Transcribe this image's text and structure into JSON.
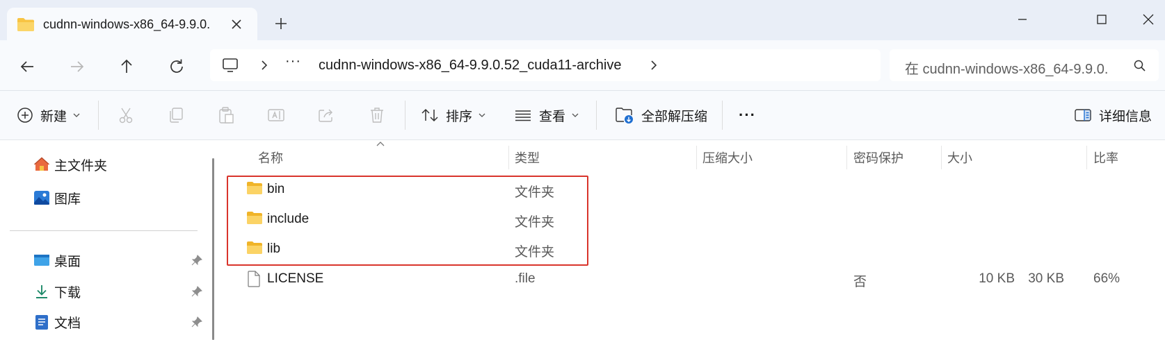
{
  "window": {
    "tab_title": "cudnn-windows-x86_64-9.9.0.",
    "icons": [
      "folder-icon",
      "close-icon",
      "plus-icon",
      "minimize-icon",
      "maximize-icon",
      "window-close-icon"
    ]
  },
  "navigation": {
    "dots": "···",
    "address_path": "cudnn-windows-x86_64-9.9.0.52_cuda11-archive",
    "search_placeholder": "在 cudnn-windows-x86_64-9.9.0.",
    "icons": [
      "back-arrow-icon",
      "forward-arrow-icon",
      "up-arrow-icon",
      "refresh-icon",
      "this-pc-icon",
      "chevron-right-icon",
      "search-icon"
    ]
  },
  "toolbar": {
    "new_label": "新建",
    "sort_label": "排序",
    "view_label": "查看",
    "extract_all_label": "全部解压缩",
    "more_label": "···",
    "details_label": "详细信息",
    "icons": [
      "cut-icon",
      "copy-icon",
      "paste-icon",
      "rename-icon",
      "share-icon",
      "delete-icon"
    ]
  },
  "sidebar": {
    "items": [
      {
        "label": "主文件夹",
        "icon": "home-icon",
        "pinned": false
      },
      {
        "label": "图库",
        "icon": "gallery-icon",
        "pinned": false
      },
      {
        "label": "桌面",
        "icon": "desktop-icon",
        "pinned": true
      },
      {
        "label": "下载",
        "icon": "download-icon",
        "pinned": true
      },
      {
        "label": "文档",
        "icon": "document-icon",
        "pinned": true
      }
    ]
  },
  "columns": {
    "name": "名称",
    "type": "类型",
    "compressed_size": "压缩大小",
    "password": "密码保护",
    "size": "大小",
    "ratio": "比率"
  },
  "files": [
    {
      "name": "bin",
      "type": "文件夹",
      "compressed_size": "",
      "password": "",
      "size": "",
      "ratio": "",
      "icon": "folder-icon"
    },
    {
      "name": "include",
      "type": "文件夹",
      "compressed_size": "",
      "password": "",
      "size": "",
      "ratio": "",
      "icon": "folder-icon"
    },
    {
      "name": "lib",
      "type": "文件夹",
      "compressed_size": "",
      "password": "",
      "size": "",
      "ratio": "",
      "icon": "folder-icon"
    },
    {
      "name": "LICENSE",
      "type": ".file",
      "compressed_size": "10 KB",
      "password": "否",
      "size": "30 KB",
      "ratio": "66%",
      "icon": "file-icon"
    }
  ],
  "colors": {
    "folder_yellow": "#f8c443",
    "highlight_red": "#d9342b",
    "titlebar_bg": "#e9eef7",
    "toolbar_bg": "#f8fafd"
  }
}
